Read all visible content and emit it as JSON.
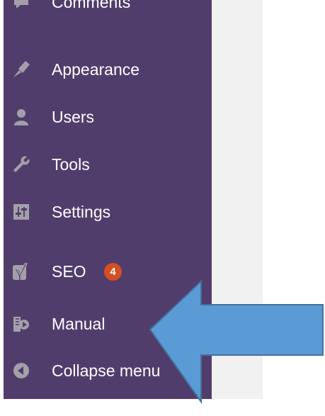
{
  "sidebar": {
    "items": [
      {
        "label": "Comments",
        "icon": "comments-icon"
      },
      {
        "label": "Appearance",
        "icon": "paintbrush-icon"
      },
      {
        "label": "Users",
        "icon": "user-icon"
      },
      {
        "label": "Tools",
        "icon": "wrench-icon"
      },
      {
        "label": "Settings",
        "icon": "settings-sliders-icon"
      },
      {
        "label": "SEO",
        "icon": "yoast-icon",
        "badge": "4"
      },
      {
        "label": "Manual",
        "icon": "manual-book-icon"
      },
      {
        "label": "Collapse menu",
        "icon": "collapse-arrow-icon"
      }
    ]
  },
  "colors": {
    "sidebar_bg": "#513d6c",
    "icon": "#a3a0a9",
    "badge": "#d54e21",
    "arrow_fill": "#5b9bd5",
    "arrow_stroke": "#41719c",
    "content_bg": "#f1f1f1"
  }
}
